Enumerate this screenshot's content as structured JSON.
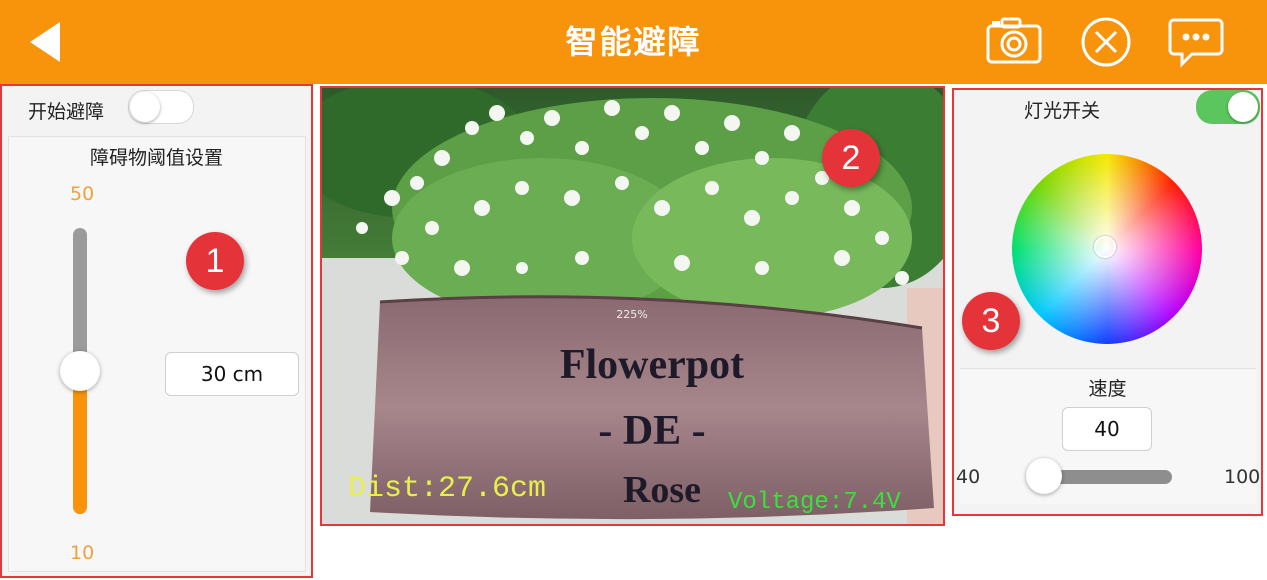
{
  "header": {
    "title": "智能避障",
    "icons": [
      "back-arrow-icon",
      "camera-icon",
      "close-circle-icon",
      "chat-icon"
    ],
    "bg_color": "#f7940c"
  },
  "left_panel": {
    "start_label": "开始避障",
    "start_toggle_on": false,
    "threshold_title": "障碍物阈值设置",
    "slider_max": "50",
    "slider_min": "10",
    "slider_value_fraction": 0.5,
    "distance_input_value": "30 cm"
  },
  "camera": {
    "zoom": "225%",
    "pot_line1": "Flowerpot",
    "pot_line2": "- DE -",
    "pot_line3": "Rose",
    "dist_text": "Dist:27.6cm",
    "voltage_text": "Voltage:7.4V"
  },
  "right_panel": {
    "light_label": "灯光开关",
    "light_toggle_on": true,
    "speed_title": "速度",
    "speed_input_value": "40",
    "speed_min": "40",
    "speed_max": "100",
    "speed_value_fraction": 0.0
  },
  "markers": [
    "1",
    "2",
    "3"
  ],
  "colors": {
    "accent": "#f7940c",
    "marker": "#e5333a",
    "toggle_on": "#5cc65e",
    "hud_dist": "#e8f04a",
    "hud_voltage": "#39e23b"
  }
}
